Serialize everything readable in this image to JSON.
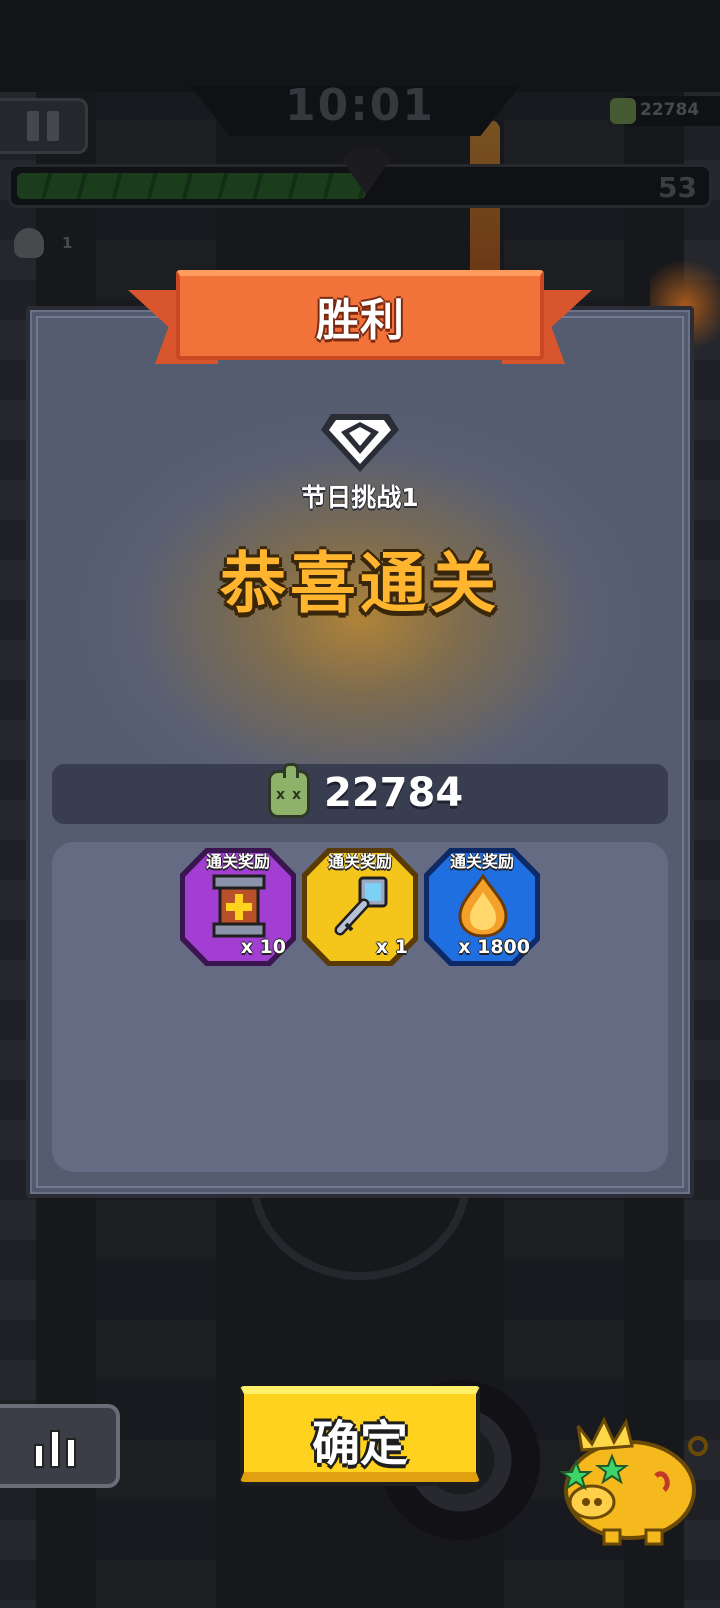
{
  "hud": {
    "timer": "10:01",
    "coins": "22784",
    "level": "53",
    "kills": "1",
    "progress_fraction": 0.5
  },
  "victory": {
    "title": "胜利",
    "stage_name": "节日挑战1",
    "message": "恭喜通关",
    "score": "22784"
  },
  "rewards": [
    {
      "tag": "通关奖励",
      "quantity": "x 10",
      "icon": "scroll-plus-icon",
      "color": "#a23fd2"
    },
    {
      "tag": "通关奖励",
      "quantity": "x 1",
      "icon": "key-icon",
      "color": "#f4c61c"
    },
    {
      "tag": "通关奖励",
      "quantity": "x 1800",
      "icon": "flame-drop-icon",
      "color": "#1f6fe0"
    }
  ],
  "buttons": {
    "confirm": "确定"
  },
  "colors": {
    "ribbon": "#f2733a",
    "congrats_text": "#ffb62e",
    "confirm_button": "#ffd21f",
    "panel": "#535a6d"
  }
}
